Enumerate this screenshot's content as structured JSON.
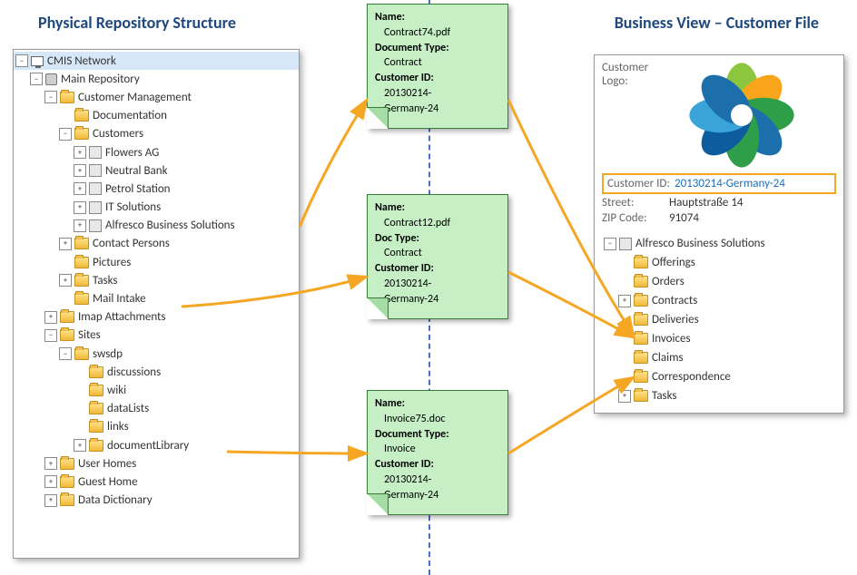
{
  "titles": {
    "left": "Physical Repository Structure",
    "right": "Business View – Customer File"
  },
  "tree": {
    "root": "CMIS Network",
    "main": "Main Repository",
    "cm": "Customer Management",
    "doc": "Documentation",
    "customers": "Customers",
    "flowers": "Flowers AG",
    "neutral": "Neutral Bank",
    "petrol": "Petrol Station",
    "itsol": "IT Solutions",
    "abs": "Alfresco Business Solutions",
    "contacts": "Contact Persons",
    "pictures": "Pictures",
    "tasks": "Tasks",
    "mail": "Mail Intake",
    "imap": "Imap Attachments",
    "sites": "Sites",
    "swsdp": "swsdp",
    "discussions": "discussions",
    "wiki": "wiki",
    "datalists": "dataLists",
    "links": "links",
    "doclib": "documentLibrary",
    "userhomes": "User Homes",
    "guesthome": "Guest Home",
    "datadict": "Data Dictionary"
  },
  "docs": {
    "d1": {
      "nameLabel": "Name:",
      "name": "Contract74.pdf",
      "typeLabel": "Document Type:",
      "type": "Contract",
      "idLabel": "Customer ID:",
      "id1": "20130214-",
      "id2": "Germany-24"
    },
    "d2": {
      "nameLabel": "Name:",
      "name": "Contract12.pdf",
      "typeLabel": "Doc Type:",
      "type": "Contract",
      "idLabel": "Customer ID:",
      "id1": "20130214-",
      "id2": "Germany-24"
    },
    "d3": {
      "nameLabel": "Name:",
      "name": "Invoice75.doc",
      "typeLabel": "Document Type:",
      "type": "Invoice",
      "idLabel": "Customer ID:",
      "id1": "20130214-",
      "id2": "Germany-24"
    }
  },
  "biz": {
    "logoLabel": "Customer Logo:",
    "custIdLabel": "Customer ID:",
    "custId": "20130214-Germany-24",
    "streetLabel": "Street:",
    "street": "Hauptstraße 14",
    "zipLabel": "ZIP Code:",
    "zip": "91074",
    "root": "Alfresco Business Solutions",
    "offerings": "Offerings",
    "orders": "Orders",
    "contracts": "Contracts",
    "deliveries": "Deliveries",
    "invoices": "Invoices",
    "claims": "Claims",
    "correspondence": "Correspondence",
    "tasks": "Tasks"
  }
}
